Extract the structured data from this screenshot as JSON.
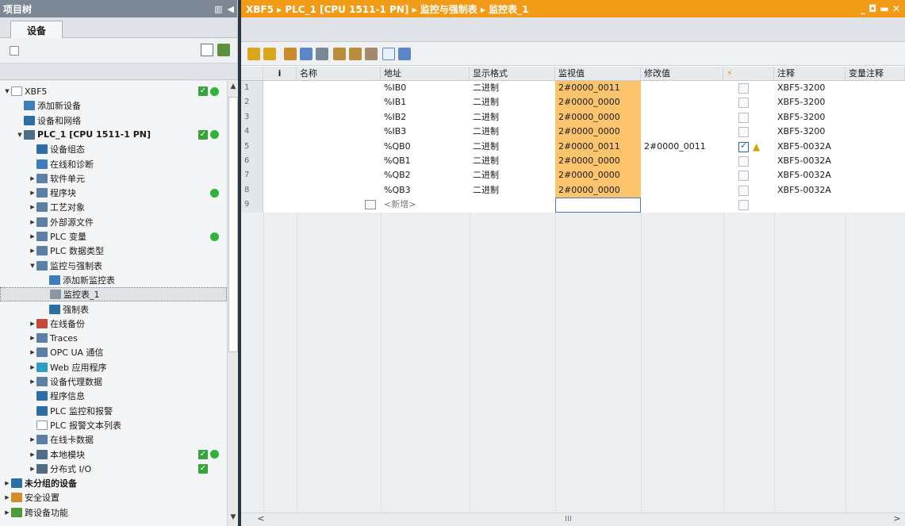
{
  "left": {
    "title": "项目树",
    "tab": "设备",
    "tree": [
      {
        "label": "XBF5",
        "indent": 0,
        "tw": "▼",
        "icon": "doc",
        "status": [
          "chk",
          "dot"
        ],
        "bold": false
      },
      {
        "label": "添加新设备",
        "indent": 1,
        "tw": "",
        "icon": "add",
        "status": [],
        "bold": false
      },
      {
        "label": "设备和网络",
        "indent": 1,
        "tw": "",
        "icon": "net",
        "status": [],
        "bold": false
      },
      {
        "label": "PLC_1 [CPU 1511-1 PN]",
        "indent": 1,
        "tw": "▼",
        "icon": "plc",
        "status": [
          "chk",
          "dot"
        ],
        "bold": true
      },
      {
        "label": "设备组态",
        "indent": 2,
        "tw": "",
        "icon": "net",
        "status": [],
        "bold": false
      },
      {
        "label": "在线和诊断",
        "indent": 2,
        "tw": "",
        "icon": "add",
        "status": [],
        "bold": false
      },
      {
        "label": "软件单元",
        "indent": 2,
        "tw": "▶",
        "icon": "fold",
        "status": [],
        "bold": false
      },
      {
        "label": "程序块",
        "indent": 2,
        "tw": "▶",
        "icon": "fold",
        "status": [
          "",
          "dot"
        ],
        "bold": false
      },
      {
        "label": "工艺对象",
        "indent": 2,
        "tw": "▶",
        "icon": "fold",
        "status": [],
        "bold": false
      },
      {
        "label": "外部源文件",
        "indent": 2,
        "tw": "▶",
        "icon": "fold",
        "status": [],
        "bold": false
      },
      {
        "label": "PLC 变量",
        "indent": 2,
        "tw": "▶",
        "icon": "fold",
        "status": [
          "",
          "dot"
        ],
        "bold": false
      },
      {
        "label": "PLC 数据类型",
        "indent": 2,
        "tw": "▶",
        "icon": "fold",
        "status": [],
        "bold": false
      },
      {
        "label": "监控与强制表",
        "indent": 2,
        "tw": "▼",
        "icon": "fold",
        "status": [],
        "bold": false
      },
      {
        "label": "添加新监控表",
        "indent": 3,
        "tw": "",
        "icon": "add",
        "status": [],
        "bold": false
      },
      {
        "label": "监控表_1",
        "indent": 3,
        "tw": "",
        "icon": "gry",
        "status": [],
        "bold": false,
        "selected": true
      },
      {
        "label": "强制表",
        "indent": 3,
        "tw": "",
        "icon": "net",
        "status": [],
        "bold": false
      },
      {
        "label": "在线备份",
        "indent": 2,
        "tw": "▶",
        "icon": "red",
        "status": [],
        "bold": false
      },
      {
        "label": "Traces",
        "indent": 2,
        "tw": "▶",
        "icon": "fold",
        "status": [],
        "bold": false
      },
      {
        "label": "OPC UA 通信",
        "indent": 2,
        "tw": "▶",
        "icon": "fold",
        "status": [],
        "bold": false
      },
      {
        "label": "Web 应用程序",
        "indent": 2,
        "tw": "▶",
        "icon": "cyan",
        "status": [],
        "bold": false
      },
      {
        "label": "设备代理数据",
        "indent": 2,
        "tw": "▶",
        "icon": "fold",
        "status": [],
        "bold": false
      },
      {
        "label": "程序信息",
        "indent": 2,
        "tw": "",
        "icon": "net",
        "status": [],
        "bold": false
      },
      {
        "label": "PLC 监控和报警",
        "indent": 2,
        "tw": "",
        "icon": "net",
        "status": [],
        "bold": false
      },
      {
        "label": "PLC 报警文本列表",
        "indent": 2,
        "tw": "",
        "icon": "doc",
        "status": [],
        "bold": false
      },
      {
        "label": "在线卡数据",
        "indent": 2,
        "tw": "▶",
        "icon": "fold",
        "status": [],
        "bold": false
      },
      {
        "label": "本地模块",
        "indent": 2,
        "tw": "▶",
        "icon": "plc",
        "status": [
          "chk",
          "dot"
        ],
        "bold": false
      },
      {
        "label": "分布式 I/O",
        "indent": 2,
        "tw": "▶",
        "icon": "plc",
        "status": [
          "chk"
        ],
        "bold": false
      },
      {
        "label": "未分组的设备",
        "indent": 0,
        "tw": "▶",
        "icon": "net",
        "status": [],
        "bold": true
      },
      {
        "label": "安全设置",
        "indent": 0,
        "tw": "▶",
        "icon": "org",
        "status": [],
        "bold": false
      },
      {
        "label": "跨设备功能",
        "indent": 0,
        "tw": "▶",
        "icon": "grn",
        "status": [],
        "bold": false
      }
    ]
  },
  "right": {
    "breadcrumb": "XBF5 ▸ PLC_1 [CPU 1511-1 PN] ▸ 监控与强制表 ▸ 监控表_1",
    "columns": [
      "i",
      "名称",
      "地址",
      "显示格式",
      "监视值",
      "修改值",
      "⚡",
      "注释",
      "变量注释"
    ],
    "rows": [
      {
        "n": "1",
        "addr": "%IB0",
        "fmt": "二进制",
        "mon": "2#0000_0011",
        "mod": "",
        "chk": false,
        "warn": false,
        "cmt": "XBF5-3200"
      },
      {
        "n": "2",
        "addr": "%IB1",
        "fmt": "二进制",
        "mon": "2#0000_0000",
        "mod": "",
        "chk": false,
        "warn": false,
        "cmt": "XBF5-3200"
      },
      {
        "n": "3",
        "addr": "%IB2",
        "fmt": "二进制",
        "mon": "2#0000_0000",
        "mod": "",
        "chk": false,
        "warn": false,
        "cmt": "XBF5-3200"
      },
      {
        "n": "4",
        "addr": "%IB3",
        "fmt": "二进制",
        "mon": "2#0000_0000",
        "mod": "",
        "chk": false,
        "warn": false,
        "cmt": "XBF5-3200"
      },
      {
        "n": "5",
        "addr": "%QB0",
        "fmt": "二进制",
        "mon": "2#0000_0011",
        "mod": "2#0000_0011",
        "chk": true,
        "warn": true,
        "cmt": "XBF5-0032A"
      },
      {
        "n": "6",
        "addr": "%QB1",
        "fmt": "二进制",
        "mon": "2#0000_0000",
        "mod": "",
        "chk": false,
        "warn": false,
        "cmt": "XBF5-0032A"
      },
      {
        "n": "7",
        "addr": "%QB2",
        "fmt": "二进制",
        "mon": "2#0000_0000",
        "mod": "",
        "chk": false,
        "warn": false,
        "cmt": "XBF5-0032A"
      },
      {
        "n": "8",
        "addr": "%QB3",
        "fmt": "二进制",
        "mon": "2#0000_0000",
        "mod": "",
        "chk": false,
        "warn": false,
        "cmt": "XBF5-0032A"
      }
    ],
    "new_row": {
      "n": "9",
      "placeholder": "<新增>"
    }
  }
}
